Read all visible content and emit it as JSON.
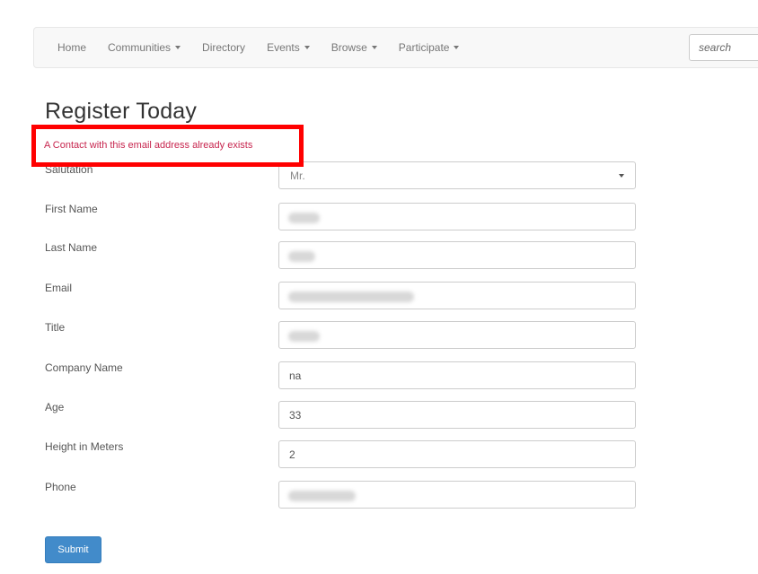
{
  "nav": {
    "items": [
      {
        "label": "Home",
        "dropdown": false
      },
      {
        "label": "Communities",
        "dropdown": true
      },
      {
        "label": "Directory",
        "dropdown": false
      },
      {
        "label": "Events",
        "dropdown": true
      },
      {
        "label": "Browse",
        "dropdown": true
      },
      {
        "label": "Participate",
        "dropdown": true
      }
    ],
    "search_placeholder": "search"
  },
  "page": {
    "title": "Register Today",
    "error_message": "A Contact with this email address already exists"
  },
  "form": {
    "salutation": {
      "label": "Salutation",
      "value": "Mr."
    },
    "first_name": {
      "label": "First Name",
      "value": ""
    },
    "last_name": {
      "label": "Last Name",
      "value": ""
    },
    "email": {
      "label": "Email",
      "value": ""
    },
    "title": {
      "label": "Title",
      "value": ""
    },
    "company_name": {
      "label": "Company Name",
      "value": "na"
    },
    "age": {
      "label": "Age",
      "value": "33"
    },
    "height": {
      "label": "Height in Meters",
      "value": "2"
    },
    "phone": {
      "label": "Phone",
      "value": ""
    },
    "submit_label": "Submit"
  },
  "colors": {
    "error_border": "#ff0000",
    "error_text": "#c7254e",
    "primary_button": "#428bca"
  }
}
